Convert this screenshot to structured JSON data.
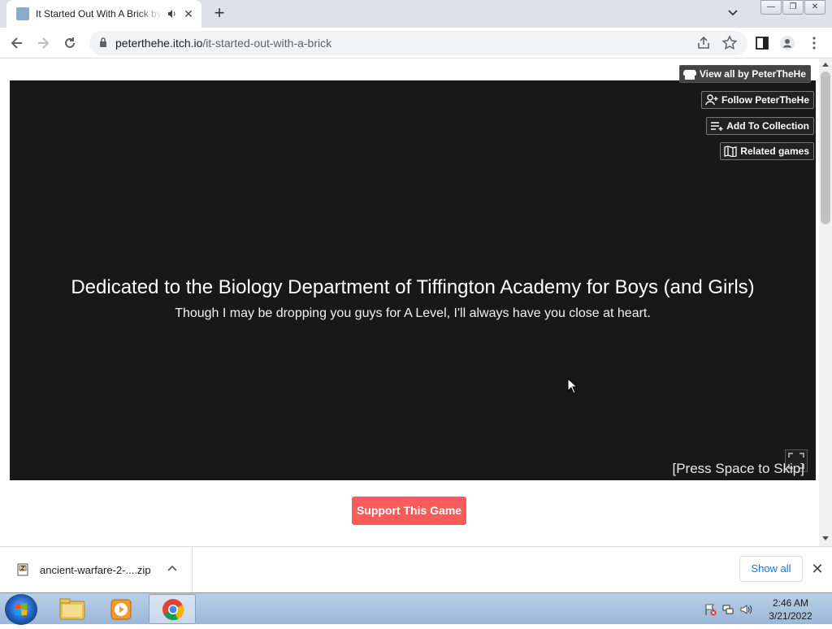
{
  "browser": {
    "tab": {
      "title": "It Started Out With A Brick by PeterTheHe"
    },
    "address": {
      "host": "peterthehe.itch.io",
      "path": "/it-started-out-with-a-brick"
    }
  },
  "page": {
    "buttons": {
      "view_all": "View all by PeterTheHe",
      "follow": "Follow PeterTheHe",
      "add_collection": "Add To Collection",
      "related": "Related games"
    },
    "game": {
      "title": "Dedicated to the Biology Department of Tiffington Academy for Boys (and Girls)",
      "subtitle": "Though I may be dropping you guys for A Level, I'll always have you close at heart.",
      "skip_hint": "[Press Space to Skip]"
    },
    "support_label": "Support This Game"
  },
  "downloads": {
    "item_name": "ancient-warfare-2-....zip",
    "show_all": "Show all"
  },
  "taskbar": {
    "time": "2:46 AM",
    "date": "3/21/2022"
  },
  "colors": {
    "support_button": "#fa5c5c",
    "game_bg": "#181818",
    "link_blue": "#1a73e8"
  }
}
